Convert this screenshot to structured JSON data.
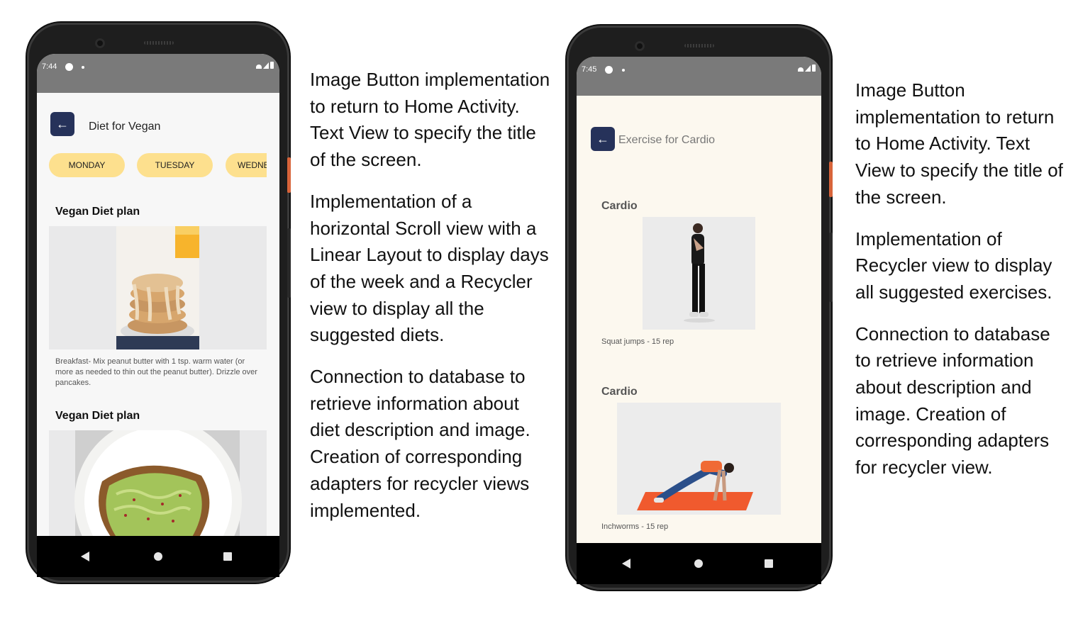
{
  "left_phone": {
    "status": {
      "time": "7:44"
    },
    "header": {
      "title": "Diet for Vegan"
    },
    "days": [
      "MONDAY",
      "TUESDAY",
      "WEDNE"
    ],
    "cards": [
      {
        "title": "Vegan Diet plan",
        "image": "pancakes-photo",
        "description": "Breakfast- Mix peanut butter with 1 tsp. warm water (or more  as needed  to thin out the peanut butter). Drizzle over pancakes."
      },
      {
        "title": "Vegan Diet plan",
        "image": "avocado-toast-photo"
      }
    ]
  },
  "right_phone": {
    "status": {
      "time": "7:45"
    },
    "header": {
      "title": "Exercise for Cardio"
    },
    "cards": [
      {
        "title": "Cardio",
        "image": "squat-jumps-photo",
        "caption": "Squat jumps - 15 rep"
      },
      {
        "title": "Cardio",
        "image": "inchworms-photo",
        "caption": "Inchworms - 15 rep"
      }
    ]
  },
  "descriptions": {
    "left": [
      "Image Button implementation to return to Home Activity. Text View to specify the title of the screen.",
      "Implementation of a horizontal Scroll view with a Linear Layout to display days of the week and a Recycler view to display all the suggested diets.",
      "Connection to database to retrieve information about diet description and image. Creation of corresponding adapters for recycler views implemented."
    ],
    "right": [
      "Image Button implementation to return to Home Activity. Text View to specify the title of the screen.",
      "Implementation of Recycler view to display all suggested exercises.",
      "Connection to database to retrieve information about description and image. Creation of corresponding adapters for recycler view."
    ]
  },
  "colors": {
    "status_bar": "#7a7a7a",
    "back_button": "#26325a",
    "day_chip": "#fde08e",
    "left_screen_bg": "#f7f7f7",
    "right_screen_bg": "#fcf8ef",
    "yoga_mat": "#f05a2e"
  }
}
